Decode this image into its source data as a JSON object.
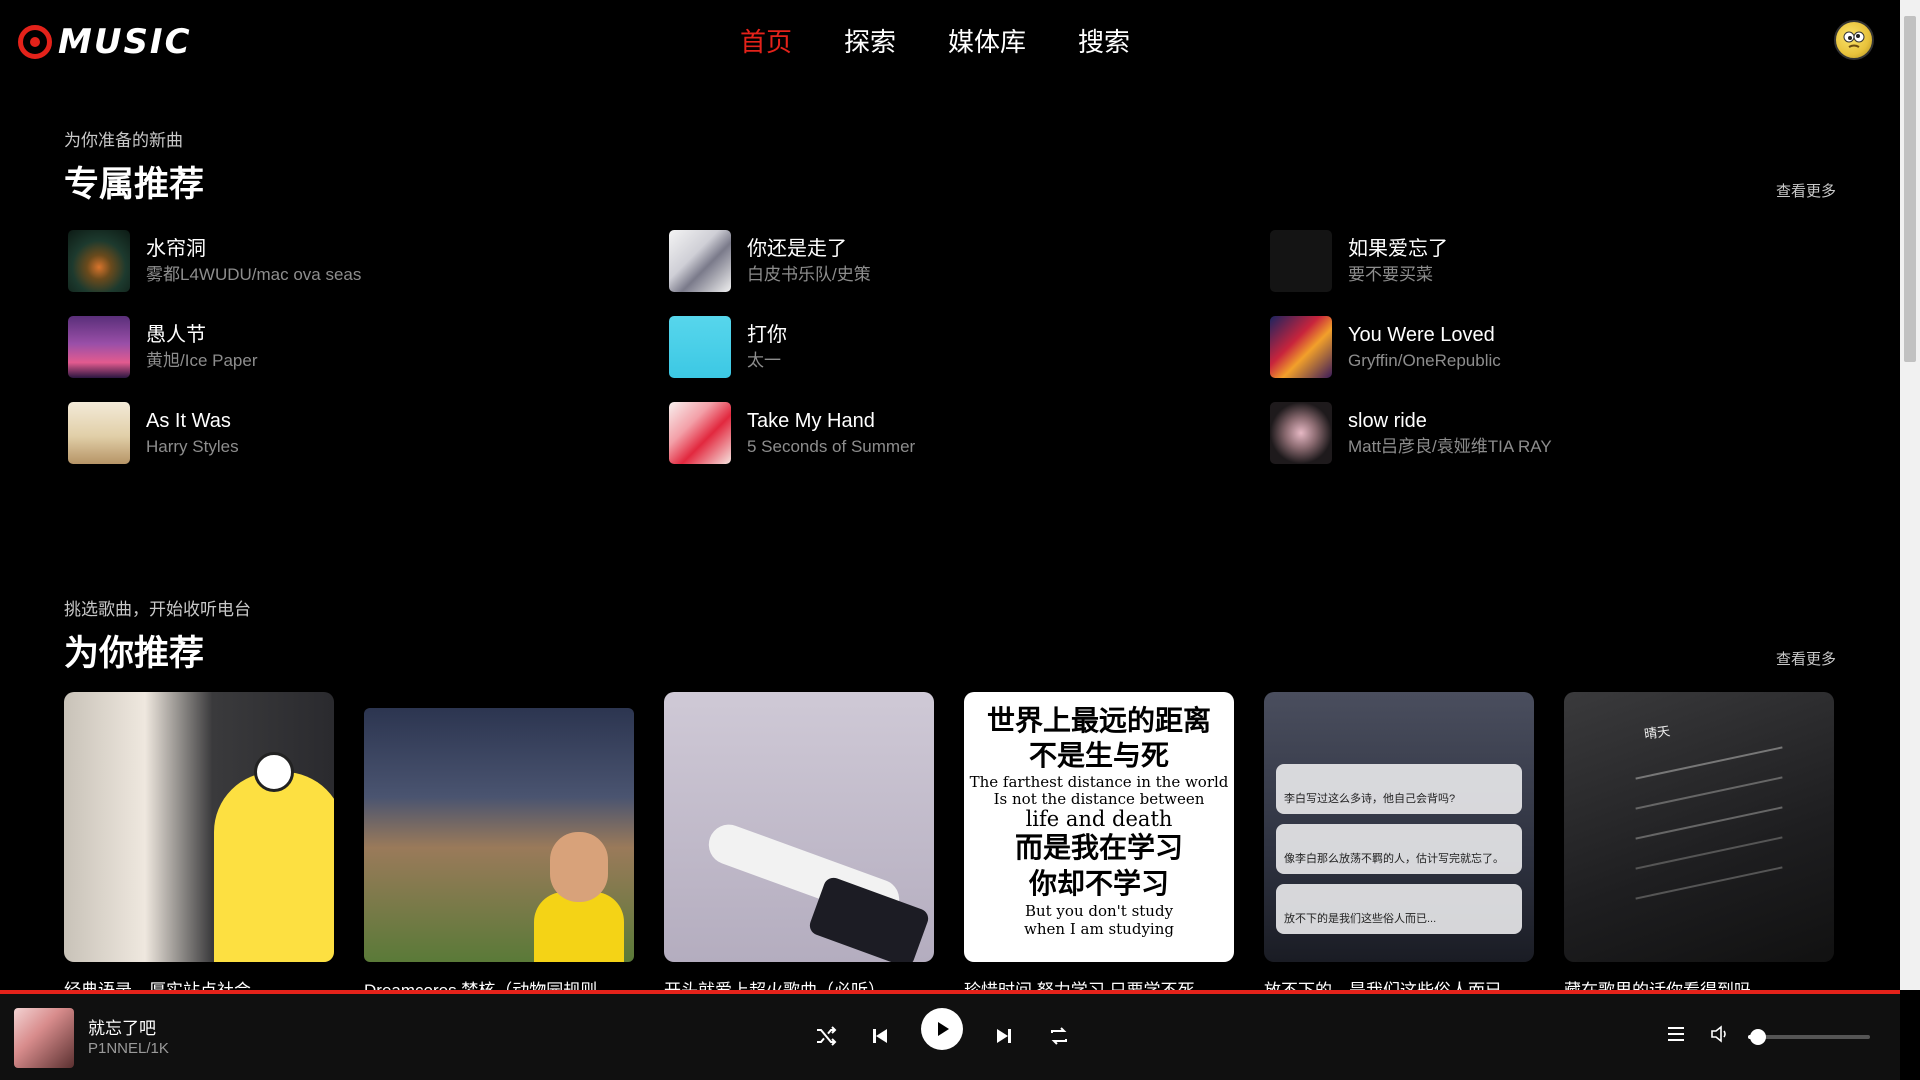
{
  "header": {
    "logo_text": "MUSIC",
    "nav": [
      {
        "label": "首页",
        "active": true
      },
      {
        "label": "探索",
        "active": false
      },
      {
        "label": "媒体库",
        "active": false
      },
      {
        "label": "搜索",
        "active": false
      }
    ]
  },
  "section1": {
    "subtitle": "为你准备的新曲",
    "title": "专属推荐",
    "see_more": "查看更多",
    "songs": [
      {
        "name": "水帘洞",
        "artist": "雾都L4WUDU/mac ova seas"
      },
      {
        "name": "你还是走了",
        "artist": "白皮书乐队/史策"
      },
      {
        "name": "如果爱忘了",
        "artist": "要不要买菜"
      },
      {
        "name": "愚人节",
        "artist": "黄旭/Ice Paper"
      },
      {
        "name": "打你",
        "artist": "太一"
      },
      {
        "name": "You Were Loved",
        "artist": "Gryffin/OneRepublic"
      },
      {
        "name": "As It Was",
        "artist": "Harry Styles"
      },
      {
        "name": "Take My Hand",
        "artist": "5 Seconds of Summer"
      },
      {
        "name": "slow ride",
        "artist": "Matt吕彦良/袁娅维TIA RAY"
      }
    ]
  },
  "section2": {
    "subtitle": "挑选歌曲，开始收听电台",
    "title": "为你推荐",
    "see_more": "查看更多",
    "cards": [
      {
        "title": "经典语录，厚实站点社会"
      },
      {
        "title": "Dreamcores 梦核（动物园规则"
      },
      {
        "title": "开头就爱上超火歌曲（必听）"
      },
      {
        "title": "珍惜时间 努力学习 只要学不死"
      },
      {
        "title": "放不下的，是我们这些俗人而已"
      },
      {
        "title": "藏在歌里的话你看得到吗"
      }
    ],
    "card3_text": {
      "line1": "世界上最远的距离",
      "line2": "不是生与死",
      "line3": "The farthest distance in the world",
      "line4": "Is not the distance between",
      "line5": "life and death",
      "line6": "而是我在学习",
      "line7": "你却不学习",
      "line8": "But you don't study",
      "line9": "when I am studying"
    },
    "card4_bubbles": [
      "李白写过这么多诗，他自己会背吗?",
      "像李白那么放荡不羁的人，估计写完就忘了。",
      "放不下的是我们这些俗人而已..."
    ],
    "card5_song_title": "晴天"
  },
  "player": {
    "title": "就忘了吧",
    "artist": "P1NNEL/1K",
    "volume": 0.08
  },
  "colors": {
    "accent": "#e4221a",
    "background": "#000000"
  }
}
